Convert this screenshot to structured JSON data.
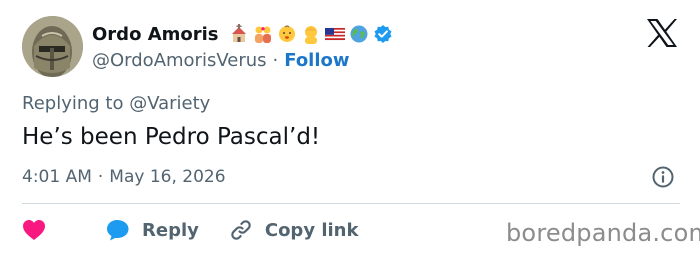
{
  "author": {
    "display_name": "Ordo Amoris",
    "handle": "@OrdoAmorisVerus",
    "follow_label": "Follow",
    "emojis": [
      "church-emoji",
      "family-emoji",
      "baby-emoji",
      "person-emoji",
      "us-flag-emoji",
      "globe-emoji",
      "verified-badge-icon"
    ]
  },
  "tweet": {
    "replying_to": "Replying to @Variety",
    "text": "He’s been Pedro Pascal’d!",
    "time": "4:01 AM",
    "separator": "·",
    "date": "May 16, 2026"
  },
  "actions": {
    "reply_label": "Reply",
    "copy_link_label": "Copy link"
  },
  "watermark": "boredpanda.com",
  "colors": {
    "follow": "#1d77c9",
    "heart": "#f91880",
    "reply_bubble": "#1d9bf0",
    "secondary_text": "#536471",
    "verified": "#1d9bf0"
  }
}
